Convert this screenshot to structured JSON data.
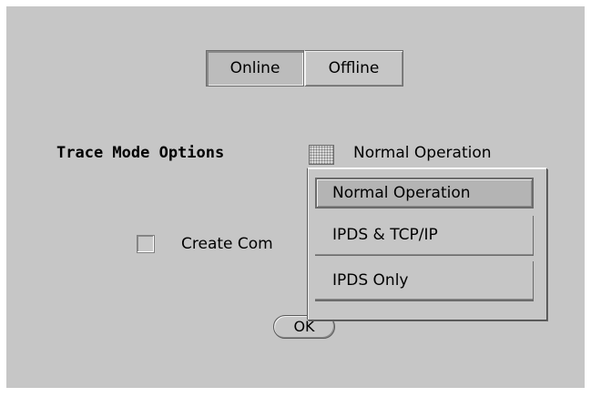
{
  "mode_toggle": {
    "online": "Online",
    "offline": "Offline",
    "selected": "Online"
  },
  "trace": {
    "label": "Trace Mode Options",
    "current": "Normal Operation",
    "options": [
      "Normal Operation",
      "IPDS & TCP/IP",
      "IPDS Only"
    ],
    "highlighted": "Normal Operation"
  },
  "checkbox": {
    "label": "Create Com",
    "checked": false
  },
  "ok_label": "OK",
  "icons": {
    "option_menu": "option-menu-indicator-icon"
  }
}
